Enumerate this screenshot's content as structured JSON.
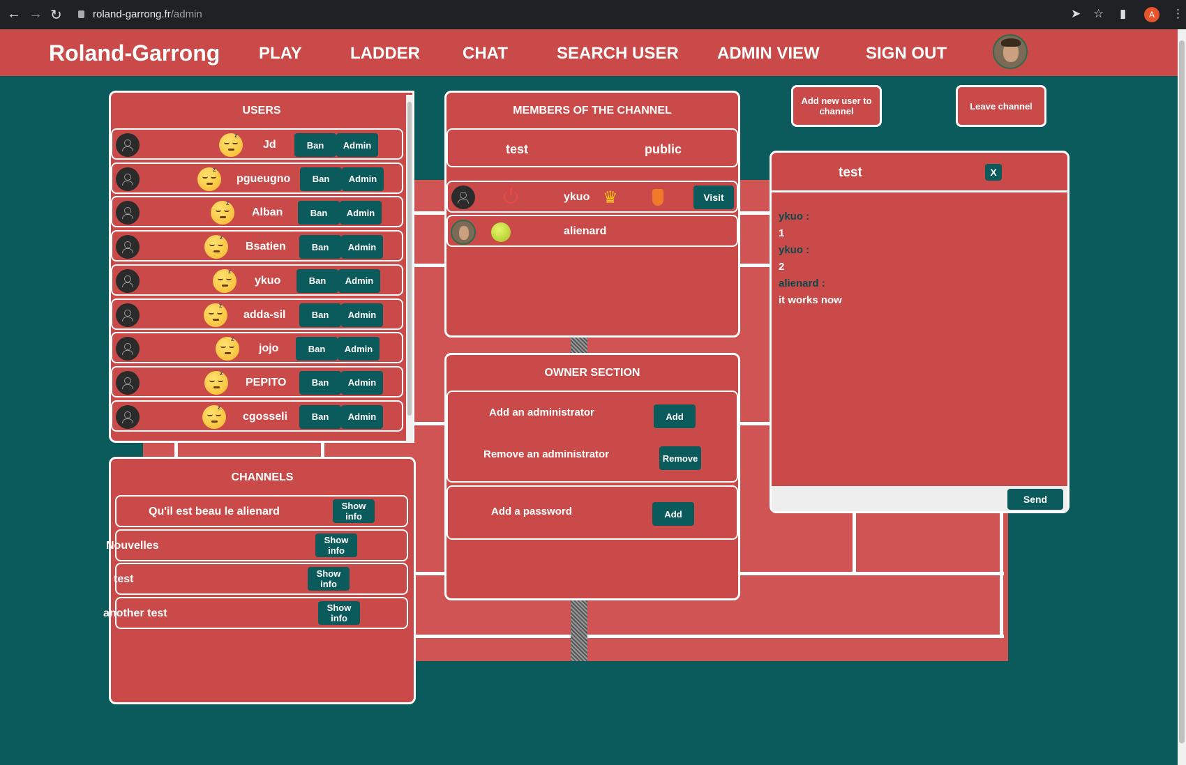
{
  "browser": {
    "url_host": "roland-garrong.fr",
    "url_path": "/admin",
    "profile_letter": "A"
  },
  "header": {
    "brand": "Roland-Garrong",
    "nav": [
      "PLAY",
      "LADDER",
      "CHAT",
      "SEARCH USER",
      "ADMIN VIEW",
      "SIGN OUT"
    ]
  },
  "users_panel": {
    "title": "USERS",
    "users": [
      {
        "name": "Jd",
        "ban": "Ban",
        "admin": "Admin"
      },
      {
        "name": "pgueugno",
        "ban": "Ban",
        "admin": "Admin"
      },
      {
        "name": "Alban",
        "ban": "Ban",
        "admin": "Admin"
      },
      {
        "name": "Bsatien",
        "ban": "Ban",
        "admin": "Admin"
      },
      {
        "name": "ykuo",
        "ban": "Ban",
        "admin": "Admin"
      },
      {
        "name": "adda-sil",
        "ban": "Ban",
        "admin": "Admin"
      },
      {
        "name": "jojo",
        "ban": "Ban",
        "admin": "Admin"
      },
      {
        "name": "PEPITO",
        "ban": "Ban",
        "admin": "Admin"
      },
      {
        "name": "cgosseli",
        "ban": "Ban",
        "admin": "Admin"
      }
    ]
  },
  "channels_panel": {
    "title": "CHANNELS",
    "show_info": "Show info",
    "channels": [
      "Qu'il est beau le alienard",
      "Nouvelles",
      "test",
      "another test"
    ]
  },
  "members_panel": {
    "title": "MEMBERS OF THE CHANNEL",
    "channel_name": "test",
    "channel_type": "public",
    "members": [
      {
        "name": "ykuo",
        "visit": "Visit"
      },
      {
        "name": "alienard"
      }
    ]
  },
  "owner_panel": {
    "title": "OWNER SECTION",
    "add_admin": "Add an administrator",
    "add_label": "Add",
    "remove_admin": "Remove an administrator",
    "remove_label": "Remove",
    "add_password": "Add a password"
  },
  "actions": {
    "add_user": "Add new user to channel",
    "leave": "Leave channel"
  },
  "chat": {
    "title": "test",
    "close": "X",
    "send": "Send",
    "messages": [
      {
        "author": "ykuo :",
        "text": "1"
      },
      {
        "author": "ykuo :",
        "text": "2"
      },
      {
        "author": "alienard :",
        "text": "it works now"
      }
    ]
  }
}
